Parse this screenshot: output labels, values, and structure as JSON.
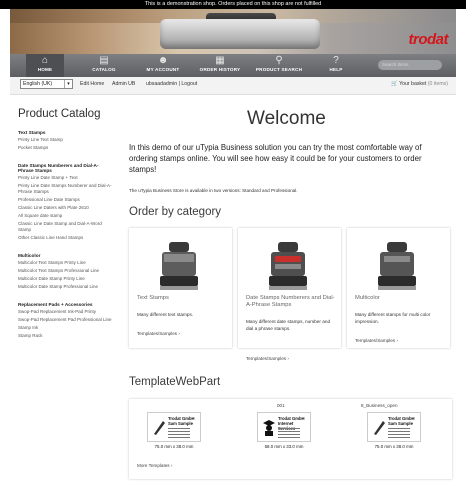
{
  "demo_notice": "This is a demonstration shop. Orders placed on this shop are not fulfilled",
  "banner": {
    "brand": "trodat"
  },
  "nav": {
    "items": [
      {
        "label": "HOME",
        "icon": "home-icon"
      },
      {
        "label": "CATALOG",
        "icon": "catalog-icon"
      },
      {
        "label": "MY ACCOUNT",
        "icon": "account-icon"
      },
      {
        "label": "ORDER HISTORY",
        "icon": "order-history-icon"
      },
      {
        "label": "PRODUCT SEARCH",
        "icon": "search-icon"
      },
      {
        "label": "HELP",
        "icon": "help-icon"
      }
    ],
    "search_placeholder": "Search Items"
  },
  "toolbar": {
    "language": "English (UK)",
    "links": [
      "Edit Home",
      "Admin UB",
      "ubsaadadmin | Logout"
    ],
    "basket_label": "Your basket",
    "basket_count": "(0 items)"
  },
  "sidebar": {
    "title": "Product Catalog",
    "sections": [
      {
        "heading": "Text Stamps",
        "links": [
          "Printy Line Text Stamp",
          "Pocket Stamps"
        ]
      },
      {
        "heading": "Date Stamps Numberers and Dial-A-Phrase Stamps",
        "links": [
          "Printy Line Date Stamp + Text",
          "Printy Line Date Stamps Numberer and Dial-A-Phrase Stamps",
          "Professional Line Date Stamps",
          "Classic Line Daters with Plate 2610",
          "All Square date stamp",
          "Classic Line Date Stamp and Dial-A-Word Stamp",
          "Other Classic Line Hand Stamps"
        ]
      },
      {
        "heading": "Multicolor",
        "links": [
          "Multicolor Text Stamps Printy Line",
          "Multicolor Text Stamps Professional Line",
          "Multicolor Date Stamp Printy Line",
          "Multicolor Date Stamp Professional Line"
        ]
      },
      {
        "heading": "Replacement Pads + Accessories",
        "links": [
          "Swop-Pad Replacement Ink-Pad Printy",
          "Swop-Pad Replacement Pad Professional Line",
          "Stamp Ink",
          "Stamp Rack"
        ]
      }
    ]
  },
  "main": {
    "welcome": "Welcome",
    "intro": "In this demo of our uTypia Business solution you can try the most comfortable way of ordering stamps online. You will see how easy it could be for your customers to order stamps!",
    "editions": "The uTypia Business Store is available in two versions: Standard and Professional.",
    "order_by_category": "Order by category",
    "categories": [
      {
        "title": "Text Stamps",
        "desc": "Many different text stamps.",
        "more": "Templates/Samples"
      },
      {
        "title": "Date Stamps Numberers and Dial-A-Phrase Stamps",
        "desc": "Many different date stamps, number and dial a phrase stamps.",
        "more": "Templates/Samples"
      },
      {
        "title": "Multicolor",
        "desc": "Many different stamps for multi color impression.",
        "more": "Templates/Samples"
      }
    ],
    "template_webpart": "TemplateWebPart",
    "templates": [
      {
        "head": "",
        "company": "Trodat GmbH",
        "name": "Sam Sample",
        "size": "75.0 mm x 38.0 mm"
      },
      {
        "head": "001",
        "company": "Trodat GmbH",
        "name": "Internet Services",
        "size": "58.0 mm x 33.0 mm"
      },
      {
        "head": "8_Business_open",
        "company": "Trodat GmbH",
        "name": "Sam Sample",
        "size": "75.0 mm x 38.0 mm"
      }
    ],
    "more_templates": "More Templates"
  }
}
